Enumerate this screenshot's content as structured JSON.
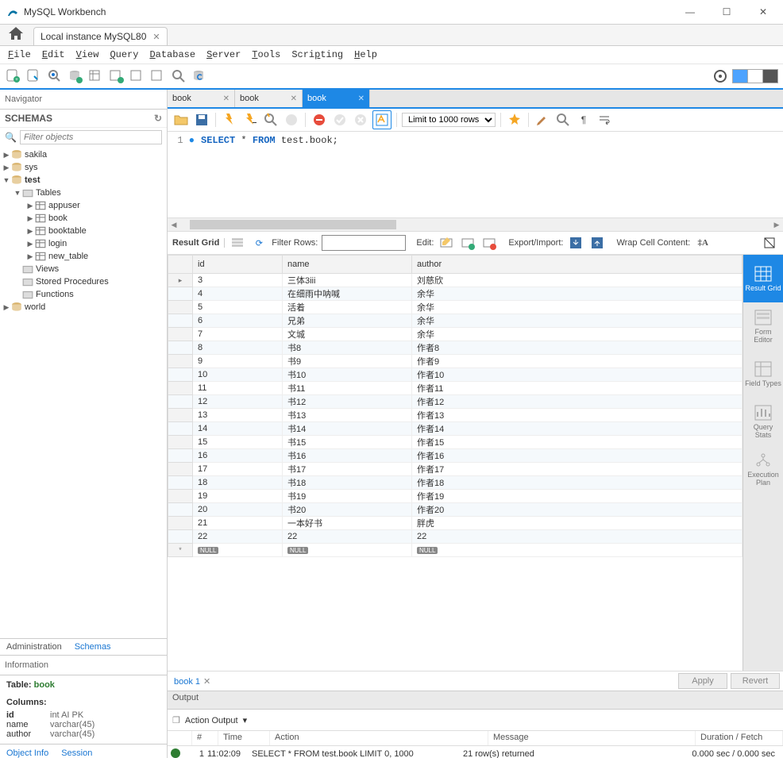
{
  "window": {
    "title": "MySQL Workbench"
  },
  "instance_tab": "Local instance MySQL80",
  "menu": [
    "File",
    "Edit",
    "View",
    "Query",
    "Database",
    "Server",
    "Tools",
    "Scripting",
    "Help"
  ],
  "navigator": {
    "title": "Navigator",
    "schemas_label": "SCHEMAS",
    "filter_placeholder": "Filter objects"
  },
  "tree": {
    "sakila": "sakila",
    "sys": "sys",
    "test": "test",
    "tables": "Tables",
    "t1": "appuser",
    "t2": "book",
    "t3": "booktable",
    "t4": "login",
    "t5": "new_table",
    "views": "Views",
    "sp": "Stored Procedures",
    "fn": "Functions",
    "world": "world"
  },
  "nav_tabs": {
    "admin": "Administration",
    "schemas": "Schemas"
  },
  "info": {
    "header": "Information",
    "table_lbl": "Table:",
    "table_val": "book",
    "columns_lbl": "Columns:",
    "c1k": "id",
    "c1v": "int AI PK",
    "c2k": "name",
    "c2v": "varchar(45)",
    "c3k": "author",
    "c3v": "varchar(45)"
  },
  "bottom_tabs": {
    "obj": "Object Info",
    "sess": "Session"
  },
  "editor_tabs": [
    {
      "label": "book",
      "active": false
    },
    {
      "label": "book",
      "active": false
    },
    {
      "label": "book",
      "active": true
    }
  ],
  "limit_label": "Limit to 1000 rows",
  "sql": {
    "line": "1",
    "kw1": "SELECT",
    "star": "*",
    "kw2": "FROM",
    "rest": " test.book;"
  },
  "result_toolbar": {
    "grid": "Result Grid",
    "filter": "Filter Rows:",
    "edit": "Edit:",
    "export": "Export/Import:",
    "wrap": "Wrap Cell Content:"
  },
  "columns": [
    "id",
    "name",
    "author"
  ],
  "rows": [
    {
      "id": "3",
      "name": "三体3iii",
      "author": "刘慈欣"
    },
    {
      "id": "4",
      "name": "在细雨中呐喊",
      "author": "余华"
    },
    {
      "id": "5",
      "name": "活着",
      "author": "余华"
    },
    {
      "id": "6",
      "name": "兄弟",
      "author": "余华"
    },
    {
      "id": "7",
      "name": "文城",
      "author": "余华"
    },
    {
      "id": "8",
      "name": "书8",
      "author": "作者8"
    },
    {
      "id": "9",
      "name": "书9",
      "author": "作者9"
    },
    {
      "id": "10",
      "name": "书10",
      "author": "作者10"
    },
    {
      "id": "11",
      "name": "书11",
      "author": "作者11"
    },
    {
      "id": "12",
      "name": "书12",
      "author": "作者12"
    },
    {
      "id": "13",
      "name": "书13",
      "author": "作者13"
    },
    {
      "id": "14",
      "name": "书14",
      "author": "作者14"
    },
    {
      "id": "15",
      "name": "书15",
      "author": "作者15"
    },
    {
      "id": "16",
      "name": "书16",
      "author": "作者16"
    },
    {
      "id": "17",
      "name": "书17",
      "author": "作者17"
    },
    {
      "id": "18",
      "name": "书18",
      "author": "作者18"
    },
    {
      "id": "19",
      "name": "书19",
      "author": "作者19"
    },
    {
      "id": "20",
      "name": "书20",
      "author": "作者20"
    },
    {
      "id": "21",
      "name": "一本好书",
      "author": "胖虎"
    },
    {
      "id": "22",
      "name": "22",
      "author": "22"
    }
  ],
  "side_tools": {
    "grid": "Result Grid",
    "form": "Form Editor",
    "types": "Field Types",
    "stats": "Query Stats",
    "plan": "Execution Plan"
  },
  "result_footer": {
    "tab": "book 1",
    "apply": "Apply",
    "revert": "Revert"
  },
  "output": {
    "header": "Output",
    "selector": "Action Output",
    "cols": {
      "n": "#",
      "time": "Time",
      "action": "Action",
      "msg": "Message",
      "dur": "Duration / Fetch"
    },
    "row": {
      "n": "1",
      "time": "11:02:09",
      "action": "SELECT * FROM test.book LIMIT 0, 1000",
      "msg": "21 row(s) returned",
      "dur": "0.000 sec / 0.000 sec"
    }
  }
}
